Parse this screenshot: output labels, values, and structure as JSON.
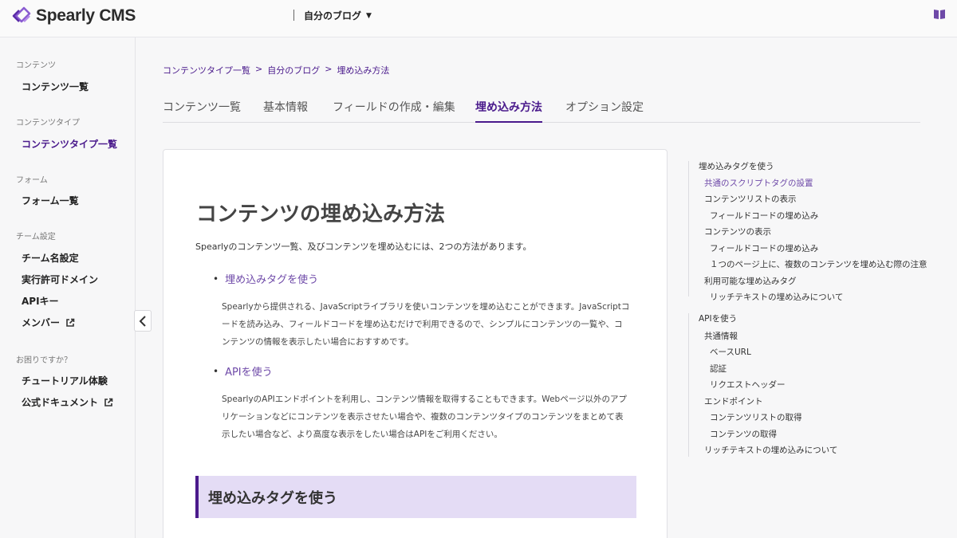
{
  "header": {
    "logo_text": "Spearly CMS",
    "project": "自分のブログ",
    "book_icon": "book-icon"
  },
  "sidebar": {
    "sections": [
      {
        "title": "コンテンツ",
        "items": [
          {
            "label": "コンテンツ一覧"
          }
        ]
      },
      {
        "title": "コンテンツタイプ",
        "items": [
          {
            "label": "コンテンツタイプ一覧"
          }
        ]
      },
      {
        "title": "フォーム",
        "items": [
          {
            "label": "フォーム一覧"
          }
        ]
      },
      {
        "title": "チーム設定",
        "items": [
          {
            "label": "チーム名設定"
          },
          {
            "label": "実行許可ドメイン"
          },
          {
            "label": "APIキー"
          },
          {
            "label": "メンバー"
          }
        ]
      },
      {
        "title": "お困りですか？",
        "items": [
          {
            "label": "チュートリアル体験"
          },
          {
            "label": "公式ドキュメント"
          }
        ]
      }
    ]
  },
  "breadcrumb": {
    "items": [
      "コンテンツタイプ一覧",
      "自分のブログ",
      "埋め込み方法"
    ],
    "separator": ">"
  },
  "tabs": [
    "コンテンツ一覧",
    "基本情報",
    "フィールドの作成・編集",
    "埋め込み方法",
    "オプション設定"
  ],
  "content": {
    "title": "コンテンツの埋め込み方法",
    "intro": "Spearlyのコンテンツ一覧、及びコンテンツを埋め込むには、2つの方法があります。",
    "methods": [
      {
        "label": "埋め込みタグを使う",
        "lines": [
          "Spearlyから提供される、JavaScriptライブラリを使いコンテンツを埋め込むことができます。JavaScriptコ",
          "ードを読み込み、フィールドコードを埋め込むだけで利用できるので、シンプルにコンテンツの一覧や、コ",
          "ンテンツの情報を表示したい場合におすすめです。"
        ]
      },
      {
        "label": "APIを使う",
        "lines": [
          "SpearlyのAPIエンドポイントを利用し、コンテンツ情報を取得することもできます。Webページ以外のアプ",
          "リケーションなどにコンテンツを表示させたい場合や、複数のコンテンツタイプのコンテンツをまとめて表",
          "示したい場合など、より高度な表示をしたい場合はAPIをご利用ください。"
        ]
      }
    ],
    "section_heading": "埋め込みタグを使う"
  },
  "toc": [
    {
      "label": "埋め込みタグを使う"
    },
    {
      "label": "共通のスクリプトタグの設置"
    },
    {
      "label": "コンテンツリストの表示"
    },
    {
      "label": "フィールドコードの埋め込み"
    },
    {
      "label": "コンテンツの表示"
    },
    {
      "label": "フィールドコードの埋め込み"
    },
    {
      "label": "１つのページ上に、複数のコンテンツを埋め込む際の注意"
    },
    {
      "label": "利用可能な埋め込みタグ"
    },
    {
      "label": "リッチテキストの埋め込みについて"
    },
    {
      "label": "APIを使う"
    },
    {
      "label": "共通情報"
    },
    {
      "label": "ベースURL"
    },
    {
      "label": "認証"
    },
    {
      "label": "リクエストヘッダー"
    },
    {
      "label": "エンドポイント"
    },
    {
      "label": "コンテンツリストの取得"
    },
    {
      "label": "コンテンツの取得"
    },
    {
      "label": "リッチテキストの埋め込みについて"
    }
  ],
  "colors": {
    "accent": "#4a1a8c",
    "link": "#6e49a8",
    "section_bg": "#e4dcf5"
  }
}
